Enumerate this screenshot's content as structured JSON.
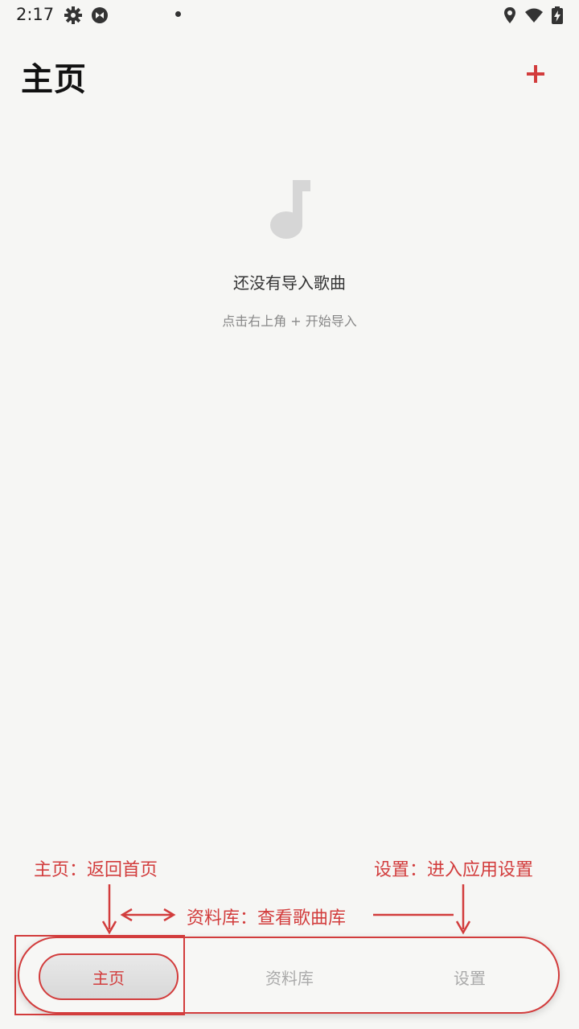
{
  "status_bar": {
    "time": "2:17",
    "icons": [
      "gear-icon",
      "app-badge-icon",
      "notification-dot",
      "location-icon",
      "wifi-icon",
      "battery-charging-icon"
    ]
  },
  "header": {
    "title": "主页",
    "add_icon": "plus-icon"
  },
  "empty_state": {
    "icon": "music-note-icon",
    "title": "还没有导入歌曲",
    "hint": "点击右上角 + 开始导入"
  },
  "annotations": {
    "home": "主页：返回首页",
    "library": "资料库：查看歌曲库",
    "settings": "设置：进入应用设置"
  },
  "bottom_nav": {
    "items": [
      {
        "label": "主页",
        "selected": true
      },
      {
        "label": "资料库",
        "selected": false
      },
      {
        "label": "设置",
        "selected": false
      }
    ]
  },
  "colors": {
    "accent": "#d23c3c",
    "background": "#f6f6f4",
    "inactive_text": "#aaaaaa"
  }
}
